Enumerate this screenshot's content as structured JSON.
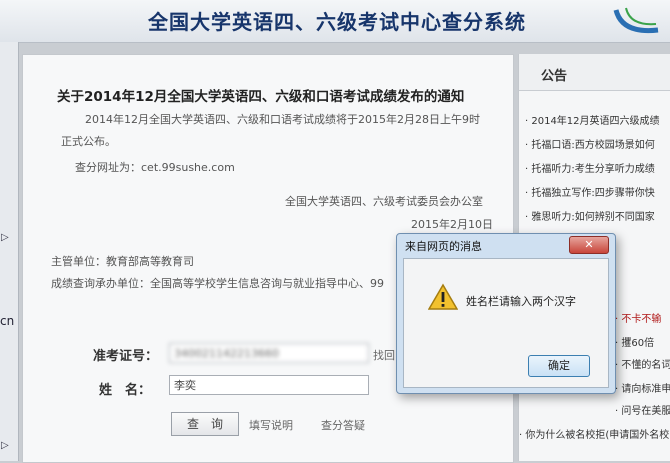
{
  "header": {
    "title": "全国大学英语四、六级考试中心查分系统"
  },
  "left_edge": {
    "text": "cn"
  },
  "notice": {
    "title": "关于2014年12月全国大学英语四、六级和口语考试成绩发布的通知",
    "body": "2014年12月全国大学英语四、六级和口语考试成绩将于2015年2月28日上午9时正式公布。",
    "link_line": "查分网址为：cet.99sushe.com",
    "issuer": "全国大学英语四、六级考试委员会办公室",
    "date": "2015年2月10日"
  },
  "meta": {
    "sponsor": "主管单位：教育部高等教育司",
    "provider": "成绩查询承办单位：全国高等学校学生信息咨询与就业指导中心、99"
  },
  "form": {
    "ticket_label": "准考证号：",
    "ticket_value": "340021142213660",
    "ticket_link": "找回",
    "name_label": "姓　名：",
    "name_value": "李奕",
    "query_button": "查　询",
    "help_link": "填写说明",
    "faq_link": "查分答疑"
  },
  "sidebar": {
    "title": "公告",
    "items": [
      "· 2014年12月英语四六级成绩",
      "· 托福口语:西方校园场景如何",
      "· 托福听力:考生分享听力成绩",
      "· 托福独立写作:四步骤带你快",
      "· 雅思听力:如何辨别不同国家",
      "· 不卡不输",
      "· 攫60倍",
      "· 不懂的名词",
      "· 请向标准申请",
      "· 问号在美服",
      "· 你为什么被名校拒(申请国外名校"
    ]
  },
  "dialog": {
    "title": "来自网页的消息",
    "close": "✕",
    "message": "姓名栏请输入两个汉字",
    "ok": "确定"
  },
  "colors": {
    "title_blue": "#17356b",
    "dialog_frame": "#cfe0f1",
    "alert_red": "#b01818"
  }
}
